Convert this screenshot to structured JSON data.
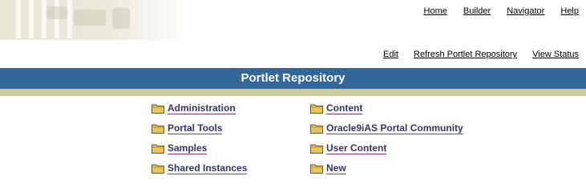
{
  "header": {
    "logo_icon": "portal-logo",
    "nav": [
      "Home",
      "Builder",
      "Navigator",
      "Help"
    ]
  },
  "actions": [
    "Edit",
    "Refresh Portlet Repository",
    "View Status"
  ],
  "banner": {
    "title": "Portlet Repository",
    "color": "#336699",
    "accent_color": "#cccc99"
  },
  "folders": {
    "left": [
      "Administration",
      "Portal Tools",
      "Samples",
      "Shared Instances"
    ],
    "right": [
      "Content",
      "Oracle9iAS Portal Community",
      "User Content",
      "New"
    ]
  },
  "icons": {
    "folder": "folder-icon"
  },
  "colors": {
    "link": "#333366",
    "link_underline": "#993366"
  }
}
